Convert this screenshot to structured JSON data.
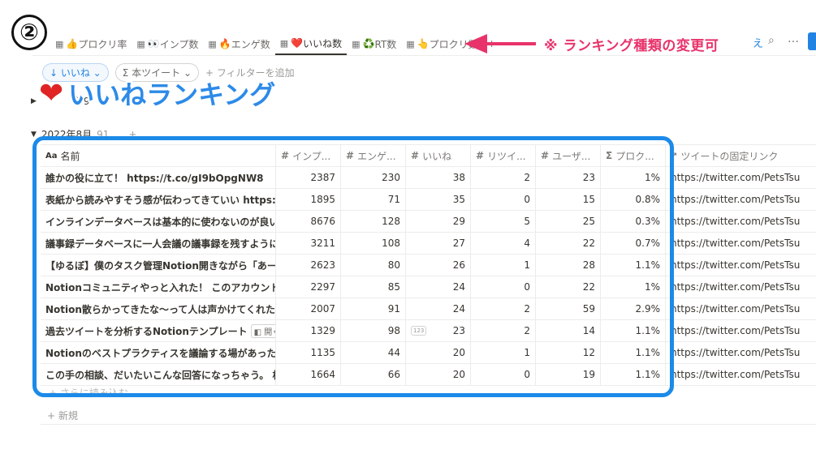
{
  "step_marker": "②",
  "tabs": [
    {
      "icon": "👍",
      "label": "プロクリ率",
      "active": false
    },
    {
      "icon": "👀",
      "label": "インプ数",
      "active": false
    },
    {
      "icon": "🔥",
      "label": "エンゲ数",
      "active": false
    },
    {
      "icon": "❤️",
      "label": "いいね数",
      "active": true
    },
    {
      "icon": "♻️",
      "label": "RT数",
      "active": false
    },
    {
      "icon": "👆",
      "label": "プロクリ数",
      "active": false
    }
  ],
  "tab_plus": "+",
  "annotation": "※ ランキング種類の変更可",
  "toolbar": {
    "extra_label": "え",
    "more": "…"
  },
  "filters": {
    "sort_label": "↓ いいね ⌄",
    "filter_label": "Σ 本ツイート ⌄",
    "add_filter": "+ フィルターを追加"
  },
  "big_title": "いいねランキング",
  "groups": [
    {
      "label": "年9",
      "collapsed": true
    },
    {
      "label": "2022年8月",
      "count": "91",
      "extra": "…",
      "plus": "+",
      "collapsed": false
    }
  ],
  "table": {
    "headers": {
      "name": "名前",
      "imp": "インプ...",
      "eng": "エンゲ...",
      "likes": "いいね",
      "rt": "リツイ...",
      "users": "ユーザ...",
      "prcl": "プロク...",
      "link": "ツイートの固定リンク"
    },
    "open_label": "開く",
    "num_badge": "123",
    "rows": [
      {
        "name": "誰かの役に立て！ https://t.co/gI9bOpgNW8",
        "imp": "2387",
        "eng": "230",
        "likes": "38",
        "rt": "2",
        "users": "23",
        "prcl": "1%",
        "link": "https://twitter.com/PetsTsubas"
      },
      {
        "name": "表紙から読みやすそう感が伝わってきていい https://t.co",
        "imp": "1895",
        "eng": "71",
        "likes": "35",
        "rt": "0",
        "users": "15",
        "prcl": "0.8%",
        "link": "https://twitter.com/PetsTsubas"
      },
      {
        "name": "インラインデータベースは基本的に使わないのが良い。",
        "imp": "8676",
        "eng": "128",
        "likes": "29",
        "rt": "5",
        "users": "25",
        "prcl": "0.3%",
        "link": "https://twitter.com/PetsTsubas"
      },
      {
        "name": "議事録データベースに一人会議の議事録を残すようにな",
        "imp": "3211",
        "eng": "108",
        "likes": "27",
        "rt": "4",
        "users": "22",
        "prcl": "0.7%",
        "link": "https://twitter.com/PetsTsubas"
      },
      {
        "name": "【ゆるぼ】僕のタスク管理Notion開きながら「あーでも",
        "imp": "2623",
        "eng": "80",
        "likes": "26",
        "rt": "1",
        "users": "28",
        "prcl": "1.1%",
        "link": "https://twitter.com/PetsTsubas"
      },
      {
        "name": "Notionコミュニティやっと入れた！ このアカウントのこ",
        "imp": "2297",
        "eng": "85",
        "likes": "24",
        "rt": "0",
        "users": "22",
        "prcl": "1%",
        "link": "https://twitter.com/PetsTsubas"
      },
      {
        "name": "Notion散らかってきたな〜って人は声かけてくれたら、",
        "imp": "2007",
        "eng": "91",
        "likes": "24",
        "rt": "2",
        "users": "59",
        "prcl": "2.9%",
        "link": "https://twitter.com/PetsTsubas"
      },
      {
        "name": "過去ツイートを分析するNotionテンプレート",
        "imp": "1329",
        "eng": "98",
        "likes": "23",
        "rt": "2",
        "users": "14",
        "prcl": "1.1%",
        "link": "https://twitter.com/PetsTsubas"
      },
      {
        "name": "Notionのベストプラクティスを議論する場があったら、",
        "imp": "1135",
        "eng": "44",
        "likes": "20",
        "rt": "1",
        "users": "12",
        "prcl": "1.1%",
        "link": "https://twitter.com/PetsTsubas"
      },
      {
        "name": "この手の相談、だいたいこんな回答になっちゃう。 相手",
        "imp": "1664",
        "eng": "66",
        "likes": "20",
        "rt": "0",
        "users": "19",
        "prcl": "1.1%",
        "link": "https://twitter.com/PetsTsubas"
      }
    ],
    "read_more": "+ さらに読み込む",
    "new_row": "+ 新規"
  },
  "colors": {
    "highlight": "#1c8ae8",
    "annotation": "#e8336b",
    "title": "#2d8ae8"
  }
}
